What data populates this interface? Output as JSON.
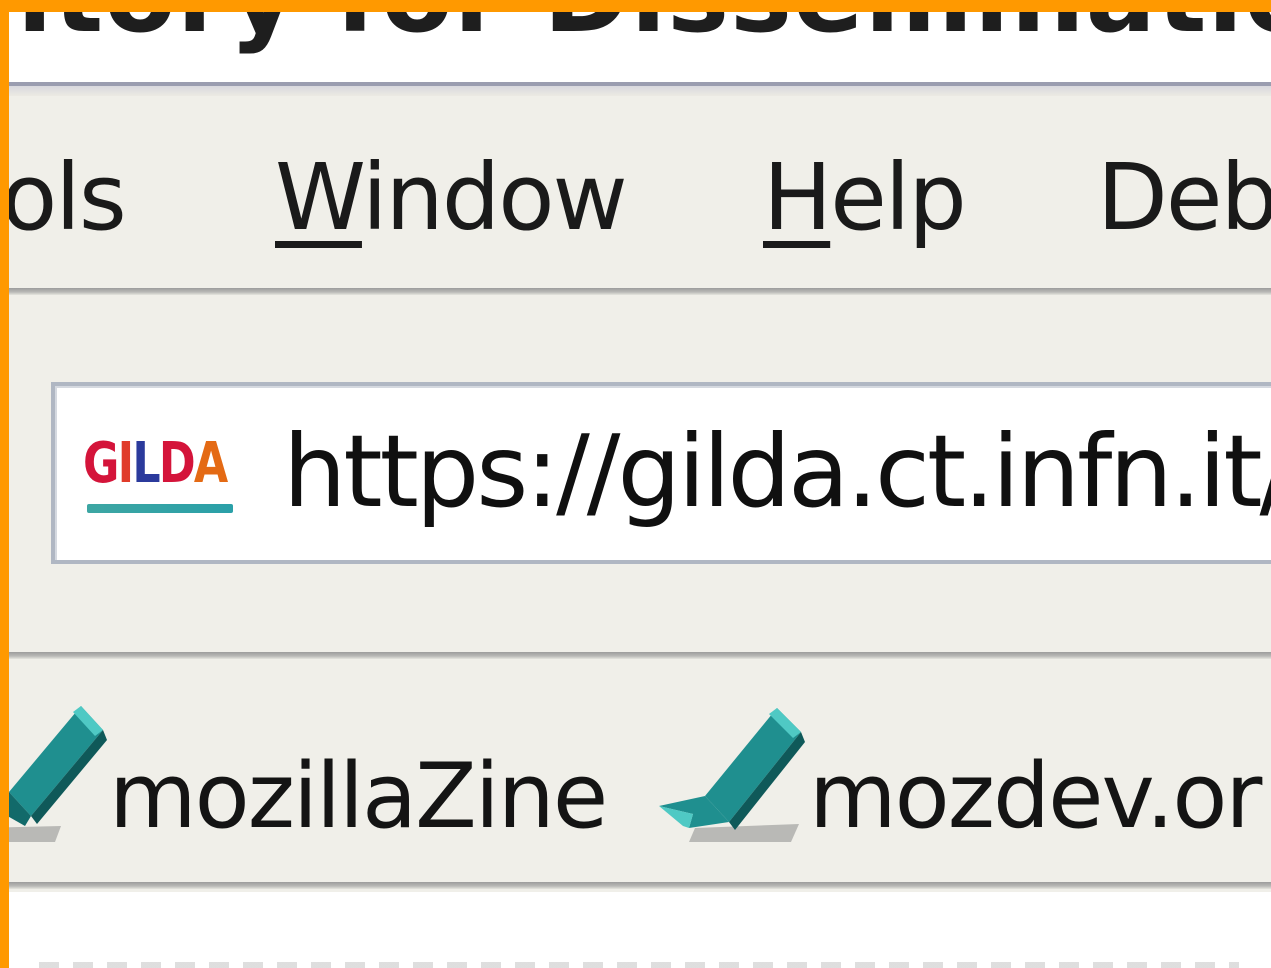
{
  "window": {
    "title": "itory for Disseminatio"
  },
  "menubar": {
    "tools": "ols",
    "window_accel": "W",
    "window_rest": "indow",
    "help_accel": "H",
    "help_rest": "elp",
    "debug": "Deb"
  },
  "navbar": {
    "url": "https://gilda.ct.infn.it/",
    "favicon": {
      "text_g": "G",
      "text_i": "I",
      "text_l": "L",
      "text_d": "D",
      "text_a": "A"
    }
  },
  "bookmarks": {
    "items": [
      {
        "label": "mozillaZine",
        "icon": "bookmark-icon"
      },
      {
        "label": "mozdev.or",
        "icon": "bookmark-icon"
      }
    ]
  },
  "colors": {
    "frame": "#ff9900",
    "chrome": "#f0efe9",
    "bookmark_icon": "#1f8f8f",
    "favicon_red": "#d4143a",
    "favicon_blue": "#2b3a9c",
    "favicon_bar": "#3da6a3"
  }
}
